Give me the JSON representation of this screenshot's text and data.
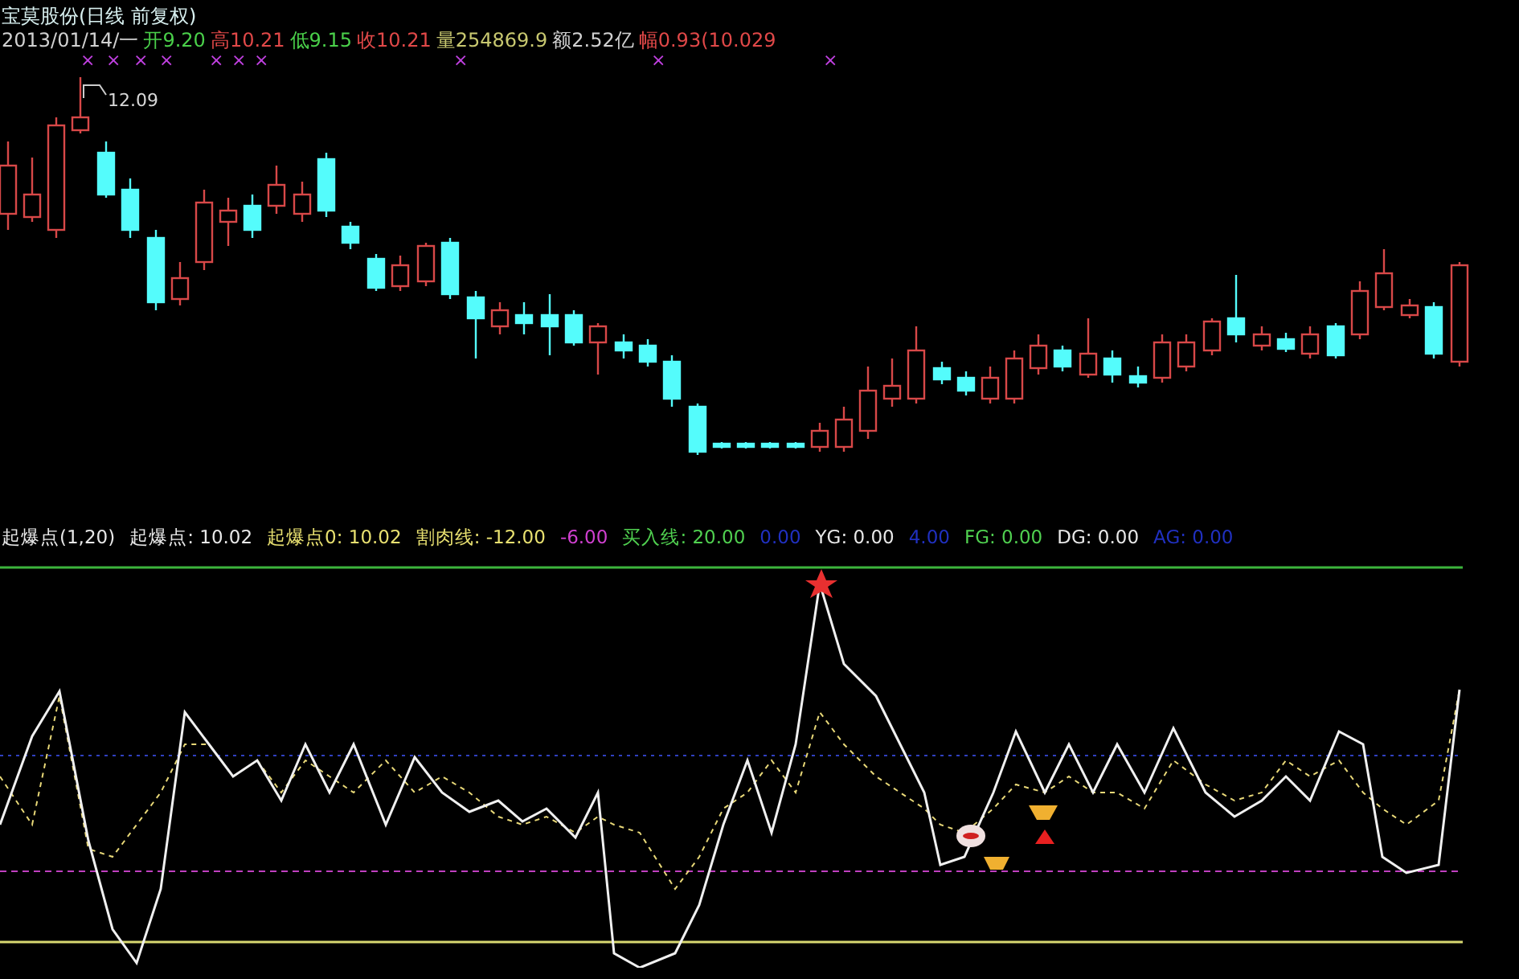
{
  "title": "宝莫股份(日线 前复权)",
  "quote": {
    "date": "2013/01/14/一",
    "fields": [
      {
        "label": "开",
        "value": "9.20",
        "color": "#4ad04a"
      },
      {
        "label": "高",
        "value": "10.21",
        "color": "#e04848"
      },
      {
        "label": "低",
        "value": "9.15",
        "color": "#4ad04a"
      },
      {
        "label": "收",
        "value": "10.21",
        "color": "#e04848"
      },
      {
        "label": "量",
        "value": "254869.9",
        "color": "#c8c870"
      },
      {
        "label": "额",
        "value": "2.52亿",
        "color": "#d0d0d0"
      },
      {
        "label": "幅",
        "value": "0.93(10.029",
        "color": "#e04848"
      }
    ]
  },
  "signal_marks": [
    "×",
    "×",
    "×",
    "×",
    "×",
    "×",
    "×",
    "×",
    "×",
    "×"
  ],
  "price_chart": {
    "high_label": "12.09"
  },
  "indicator": {
    "title": "起爆点(1,20)",
    "values": [
      {
        "text": "起爆点: 10.02",
        "color": "#e8e8e8"
      },
      {
        "text": "起爆点0: 10.02",
        "color": "#e8e070"
      },
      {
        "text": "割肉线: -12.00",
        "color": "#e8e070"
      },
      {
        "text": "-6.00",
        "color": "#d040d0"
      },
      {
        "text": "买入线: 20.00",
        "color": "#50d050"
      },
      {
        "text": "0.00",
        "color": "#2030c0"
      },
      {
        "text": "YG: 0.00",
        "color": "#e8e8e8"
      },
      {
        "text": "4.00",
        "color": "#2030c0"
      },
      {
        "text": "FG: 0.00",
        "color": "#50d050"
      },
      {
        "text": "DG: 0.00",
        "color": "#e8e8e8"
      },
      {
        "text": "AG: 0.00",
        "color": "#2030c0"
      }
    ]
  }
}
